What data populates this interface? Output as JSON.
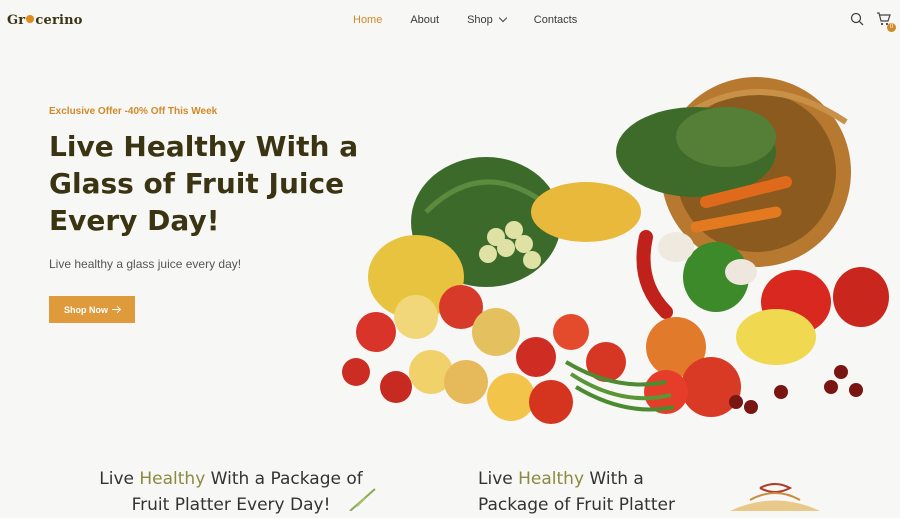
{
  "brand": {
    "pre": "Gr",
    "post": "cerino"
  },
  "nav": {
    "items": [
      {
        "label": "Home",
        "active": true
      },
      {
        "label": "About",
        "active": false
      },
      {
        "label": "Shop",
        "active": false,
        "dropdown": true
      },
      {
        "label": "Contacts",
        "active": false
      }
    ],
    "cart_count": "0"
  },
  "hero": {
    "eyebrow": "Exclusive Offer -40% Off This Week",
    "headline": "Live Healthy With a Glass of Fruit Juice Every Day!",
    "subline": "Live healthy a glass juice every day!",
    "cta": "Shop Now"
  },
  "promos": [
    {
      "pre": "Live ",
      "highlight": "Healthy",
      "post": " With a Package of Fruit Platter Every Day!"
    },
    {
      "pre": "Live ",
      "highlight": "Healthy",
      "post": " With a Package of Fruit Platter"
    }
  ],
  "colors": {
    "accent": "#d08a2a",
    "button": "#df9a3b",
    "heading": "#3a3413",
    "highlight": "#8a8a42"
  }
}
